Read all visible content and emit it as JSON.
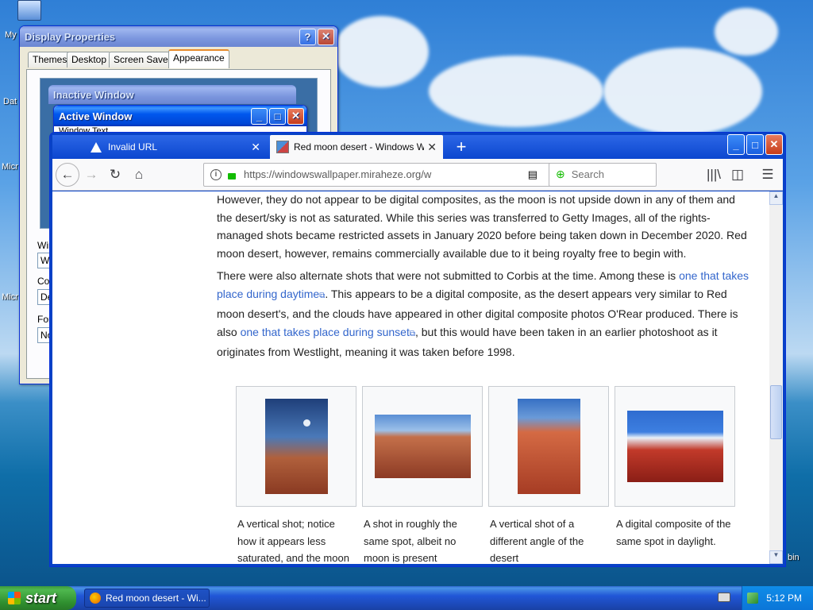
{
  "desktop": {
    "icons": [
      "My",
      "Dat",
      "Micr",
      "Micr",
      "bin"
    ]
  },
  "display_properties": {
    "title": "Display Properties",
    "tabs": [
      "Themes",
      "Desktop",
      "Screen Saver",
      "Appearance"
    ],
    "selected_tab": "Appearance",
    "preview": {
      "inactive_title": "Inactive Window",
      "active_title": "Active Window",
      "window_text": "Window Text"
    },
    "labels": {
      "windows": "Win",
      "color": "Col",
      "font": "Fon"
    },
    "values": {
      "windows": "W",
      "color": "De",
      "font": "No"
    }
  },
  "browser": {
    "tabs": [
      {
        "label": "Invalid URL",
        "icon": "warning-icon"
      },
      {
        "label": "Red moon desert - Windows Wallp",
        "icon": "thumbnail-icon"
      }
    ],
    "url": "https://windowswallpaper.miraheze.org/w",
    "search_placeholder": "Search",
    "article": {
      "p1": "However, they do not appear to be digital composites, as the moon is not upside down in any of them and the desert/sky is not as saturated. While this series was transferred to Getty Images, all of the rights-managed shots became restricted assets in January 2020 before being taken down in December 2020. Red moon desert, however, remains commercially available due to it being royalty free to begin with.",
      "p2a": "There were also alternate shots that were not submitted to Corbis at the time. Among these is ",
      "link1": "one that takes place during daytime",
      "p2b": ". This appears to be a digital composite, as the desert appears very similar to Red moon desert's, and the clouds have appeared in other digital composite photos O'Rear produced. There is also ",
      "link2": "one that takes place during sunset",
      "p2c": ", but this would have been taken in an earlier photoshoot as it originates from Westlight, meaning it was taken before 1998."
    },
    "gallery": [
      {
        "caption": "A vertical shot; notice how it appears less saturated, and the moon"
      },
      {
        "caption": "A shot in roughly the same spot, albeit no moon is present"
      },
      {
        "caption": "A vertical shot of a different angle of the desert"
      },
      {
        "caption": "A digital composite of the same spot in daylight."
      }
    ]
  },
  "taskbar": {
    "start_label": "start",
    "task_label": "Red moon desert - Wi...",
    "clock": "5:12 PM"
  }
}
